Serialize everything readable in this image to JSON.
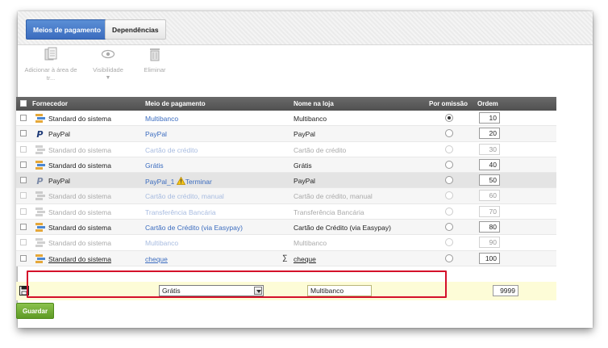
{
  "tabs": [
    {
      "label": "Meios de pagamento",
      "active": true
    },
    {
      "label": "Dependências",
      "active": false
    }
  ],
  "toolbar": {
    "add_label_1": "Adicionar à área de",
    "add_label_2": "tr...",
    "visibility_label": "Visibilidade",
    "visibility_caret": "▼",
    "delete_label": "Eliminar"
  },
  "columns": {
    "fornecedor": "Fornecedor",
    "meio": "Meio de pagamento",
    "nome": "Nome na loja",
    "omissao": "Por omissão",
    "ordem": "Ordem"
  },
  "rows": [
    {
      "provider_icon": "system-icon",
      "provider": "Standard do sistema",
      "meio": "Multibanco",
      "nome": "Multibanco",
      "default": true,
      "ordem": "10",
      "enabled": true
    },
    {
      "provider_icon": "paypal-icon",
      "provider": "PayPal",
      "meio": "PayPal",
      "nome": "PayPal",
      "default": false,
      "ordem": "20",
      "enabled": true
    },
    {
      "provider_icon": "system-icon",
      "provider": "Standard do sistema",
      "meio": "Cartão de crédito",
      "nome": "Cartão de crédito",
      "default": false,
      "ordem": "30",
      "enabled": false
    },
    {
      "provider_icon": "system-icon",
      "provider": "Standard do sistema",
      "meio": "Grátis",
      "nome": "Grátis",
      "default": false,
      "ordem": "40",
      "enabled": true
    },
    {
      "provider_icon": "paypal-icon",
      "provider": "PayPal",
      "meio": "PayPal_1",
      "meio_extra": "Terminar",
      "nome": "PayPal",
      "default": false,
      "ordem": "50",
      "enabled": true
    },
    {
      "provider_icon": "system-icon",
      "provider": "Standard do sistema",
      "meio": "Cartão de crédito, manual",
      "nome": "Cartão de crédito, manual",
      "default": false,
      "ordem": "60",
      "enabled": false
    },
    {
      "provider_icon": "system-icon",
      "provider": "Standard do sistema",
      "meio": "Transferência Bancária",
      "nome": "Transferência Bancária",
      "default": false,
      "ordem": "70",
      "enabled": false
    },
    {
      "provider_icon": "system-icon",
      "provider": "Standard do sistema",
      "meio": "Cartão de Crédito (via Easypay)",
      "nome": "Cartão de Crédito (via Easypay)",
      "default": false,
      "ordem": "80",
      "enabled": true
    },
    {
      "provider_icon": "system-icon",
      "provider": "Standard do sistema",
      "meio": "Multibanco",
      "nome": "Multibanco",
      "default": false,
      "ordem": "90",
      "enabled": false
    },
    {
      "provider_icon": "system-icon",
      "provider": "Standard do sistema",
      "meio": "cheque",
      "nome": "cheque",
      "nome_prefix": "∑",
      "default": false,
      "ordem": "100",
      "enabled": true
    }
  ],
  "new_row": {
    "meio_selected": "Grátis",
    "nome_value": "Multibanco",
    "ordem_value": "9999"
  },
  "save_label": "Guardar",
  "colors": {
    "accent": "#3b6cbf",
    "save": "#6aa62f",
    "highlight": "#d4102a",
    "new_row_bg": "#fdfcd7"
  }
}
